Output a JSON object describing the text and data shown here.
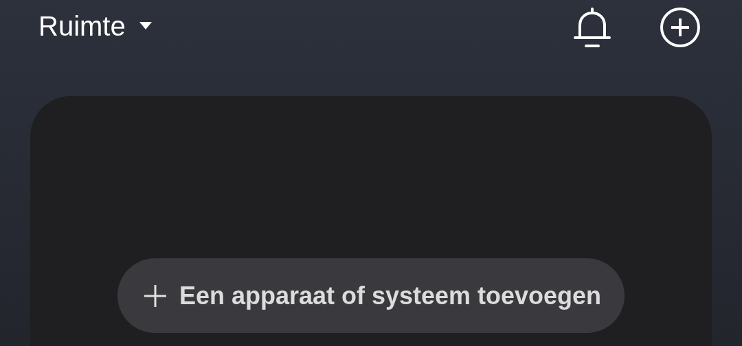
{
  "header": {
    "title": "Ruimte"
  },
  "card": {
    "add_button": {
      "label": "Een apparaat of systeem toevoegen"
    }
  }
}
